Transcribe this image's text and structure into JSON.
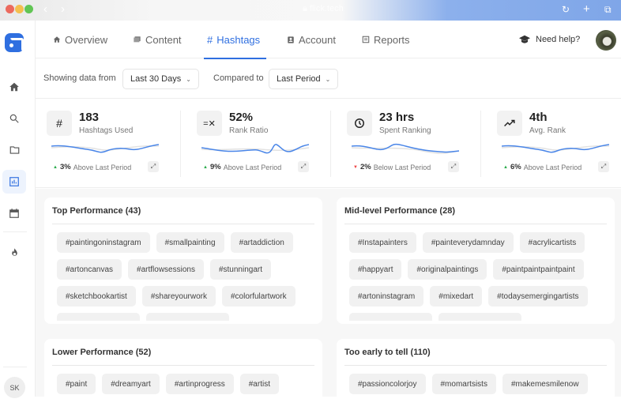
{
  "browser": {
    "url": "flick.tech"
  },
  "sidebar": {
    "items": [
      {
        "name": "home",
        "icon": "home-icon"
      },
      {
        "name": "search",
        "icon": "search-icon"
      },
      {
        "name": "folder",
        "icon": "folder-icon"
      },
      {
        "name": "analytics",
        "icon": "bar-chart-icon",
        "active": true
      },
      {
        "name": "calendar",
        "icon": "calendar-icon"
      },
      {
        "name": "trending",
        "icon": "flame-icon"
      }
    ],
    "user_initials": "SK"
  },
  "nav": {
    "tabs": [
      {
        "label": "Overview",
        "icon": "home-icon"
      },
      {
        "label": "Content",
        "icon": "images-icon"
      },
      {
        "label": "Hashtags",
        "icon": "hash-icon",
        "active": true
      },
      {
        "label": "Account",
        "icon": "account-icon"
      },
      {
        "label": "Reports",
        "icon": "report-icon"
      }
    ],
    "help_label": "Need help?"
  },
  "filters": {
    "showing_label": "Showing data from",
    "range_value": "Last 30 Days",
    "compared_label": "Compared to",
    "compare_value": "Last Period"
  },
  "stats": [
    {
      "value": "183",
      "label": "Hashtags Used",
      "icon": "hash-icon",
      "change": "3%",
      "direction": "up",
      "change_text": "Above Last Period"
    },
    {
      "value": "52%",
      "label": "Rank Ratio",
      "icon": "rank-ratio-icon",
      "change": "9%",
      "direction": "up",
      "change_text": "Above Last Period"
    },
    {
      "value": "23 hrs",
      "label": "Spent Ranking",
      "icon": "clock-icon",
      "change": "2%",
      "direction": "down",
      "change_text": "Below Last Period"
    },
    {
      "value": "4th",
      "label": "Avg. Rank",
      "icon": "trending-up-icon",
      "change": "6%",
      "direction": "up",
      "change_text": "Above Last Period"
    }
  ],
  "colors": {
    "accent": "#2f6fe0",
    "up": "#2bab4b",
    "down": "#ee4444",
    "spark_line": "#4a86e8",
    "spark_compare": "#e2e2e2"
  },
  "groups": [
    {
      "title": "Top Performance (43)",
      "tags": [
        "#paintingoninstagram",
        "#smallpainting",
        "#artaddiction",
        "#artoncanvas",
        "#artflowsessions",
        "#stunningart",
        "#sketchbookartist",
        "#shareyourwork",
        "#colorfulartwork"
      ]
    },
    {
      "title": "Mid-level Performance (28)",
      "tags": [
        "#Instapainters",
        "#painteverydamnday",
        "#acrylicartists",
        "#happyart",
        "#originalpaintings",
        "#paintpaintpaintpaint",
        "#artoninstagram",
        "#mixedart",
        "#todaysemergingartists"
      ]
    },
    {
      "title": "Lower Performance (52)",
      "tags": [
        "#paint",
        "#dreamyart",
        "#artinprogress",
        "#artist"
      ]
    },
    {
      "title": "Too early to tell (110)",
      "tags": [
        "#passioncolorjoy",
        "#momartsists",
        "#makemesmilenow"
      ]
    }
  ]
}
